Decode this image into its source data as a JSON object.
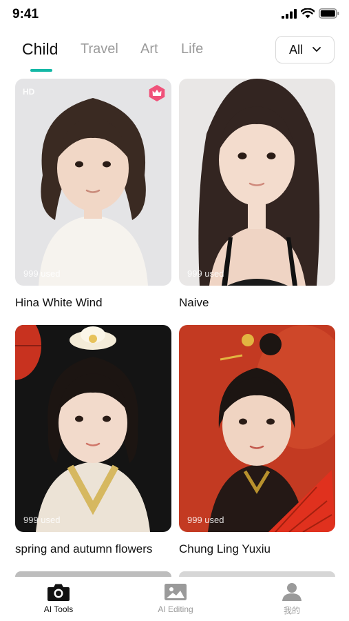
{
  "status_bar": {
    "time": "9:41"
  },
  "tabs": [
    {
      "label": "Child",
      "active": true
    },
    {
      "label": "Travel",
      "active": false
    },
    {
      "label": "Art",
      "active": false
    },
    {
      "label": "Life",
      "active": false
    }
  ],
  "filter": {
    "label": "All"
  },
  "cards": [
    {
      "title": "Hina White Wind",
      "used": "999 used",
      "badge": "HD",
      "premium": true
    },
    {
      "title": "Naive",
      "used": "999 used"
    },
    {
      "title": "spring and autumn flowers",
      "used": "999 used"
    },
    {
      "title": "Chung Ling Yuxiu",
      "used": "999 used"
    }
  ],
  "bottom_nav": [
    {
      "label": "AI Tools",
      "icon": "camera-icon",
      "active": true
    },
    {
      "label": "AI Editing",
      "icon": "image-icon",
      "active": false
    },
    {
      "label": "我的",
      "icon": "person-icon",
      "active": false
    }
  ],
  "colors": {
    "accent": "#14b8a6",
    "premium": "#f0527a",
    "inactive": "#9a9a9a"
  }
}
